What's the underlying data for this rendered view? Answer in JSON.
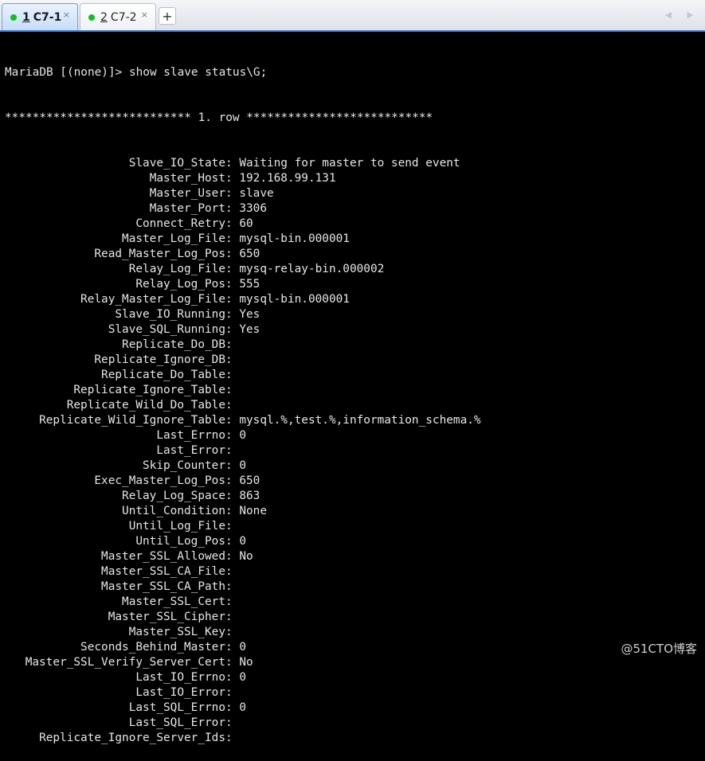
{
  "tabs": [
    {
      "number": "1",
      "label": "C7-1",
      "close": "×",
      "active": true
    },
    {
      "number": "2",
      "label": "C7-2",
      "close": "×",
      "active": false
    }
  ],
  "add_tab": "+",
  "nav_arrows": "◀ ▶",
  "terminal": {
    "command_line": "MariaDB [(none)]> show slave status\\G;",
    "row_header": "*************************** 1. row ***************************",
    "fields": [
      {
        "label": "Slave_IO_State",
        "value": "Waiting for master to send event"
      },
      {
        "label": "Master_Host",
        "value": "192.168.99.131"
      },
      {
        "label": "Master_User",
        "value": "slave"
      },
      {
        "label": "Master_Port",
        "value": "3306"
      },
      {
        "label": "Connect_Retry",
        "value": "60"
      },
      {
        "label": "Master_Log_File",
        "value": "mysql-bin.000001"
      },
      {
        "label": "Read_Master_Log_Pos",
        "value": "650"
      },
      {
        "label": "Relay_Log_File",
        "value": "mysq-relay-bin.000002"
      },
      {
        "label": "Relay_Log_Pos",
        "value": "555"
      },
      {
        "label": "Relay_Master_Log_File",
        "value": "mysql-bin.000001"
      },
      {
        "label": "Slave_IO_Running",
        "value": "Yes"
      },
      {
        "label": "Slave_SQL_Running",
        "value": "Yes"
      },
      {
        "label": "Replicate_Do_DB",
        "value": ""
      },
      {
        "label": "Replicate_Ignore_DB",
        "value": ""
      },
      {
        "label": "Replicate_Do_Table",
        "value": ""
      },
      {
        "label": "Replicate_Ignore_Table",
        "value": ""
      },
      {
        "label": "Replicate_Wild_Do_Table",
        "value": ""
      },
      {
        "label": "Replicate_Wild_Ignore_Table",
        "value": "mysql.%,test.%,information_schema.%"
      },
      {
        "label": "Last_Errno",
        "value": "0"
      },
      {
        "label": "Last_Error",
        "value": ""
      },
      {
        "label": "Skip_Counter",
        "value": "0"
      },
      {
        "label": "Exec_Master_Log_Pos",
        "value": "650"
      },
      {
        "label": "Relay_Log_Space",
        "value": "863"
      },
      {
        "label": "Until_Condition",
        "value": "None"
      },
      {
        "label": "Until_Log_File",
        "value": ""
      },
      {
        "label": "Until_Log_Pos",
        "value": "0"
      },
      {
        "label": "Master_SSL_Allowed",
        "value": "No"
      },
      {
        "label": "Master_SSL_CA_File",
        "value": ""
      },
      {
        "label": "Master_SSL_CA_Path",
        "value": ""
      },
      {
        "label": "Master_SSL_Cert",
        "value": ""
      },
      {
        "label": "Master_SSL_Cipher",
        "value": ""
      },
      {
        "label": "Master_SSL_Key",
        "value": ""
      },
      {
        "label": "Seconds_Behind_Master",
        "value": "0"
      },
      {
        "label": "Master_SSL_Verify_Server_Cert",
        "value": "No"
      },
      {
        "label": "Last_IO_Errno",
        "value": "0"
      },
      {
        "label": "Last_IO_Error",
        "value": ""
      },
      {
        "label": "Last_SQL_Errno",
        "value": "0"
      },
      {
        "label": "Last_SQL_Error",
        "value": ""
      },
      {
        "label": "Replicate_Ignore_Server_Ids",
        "value": ""
      }
    ]
  },
  "watermark": "@51CTO博客",
  "colors": {
    "terminal_bg": "#000000",
    "terminal_fg": "#e6e6e6",
    "status_dot": "#10c020",
    "tab_accent": "#3a78d4"
  }
}
